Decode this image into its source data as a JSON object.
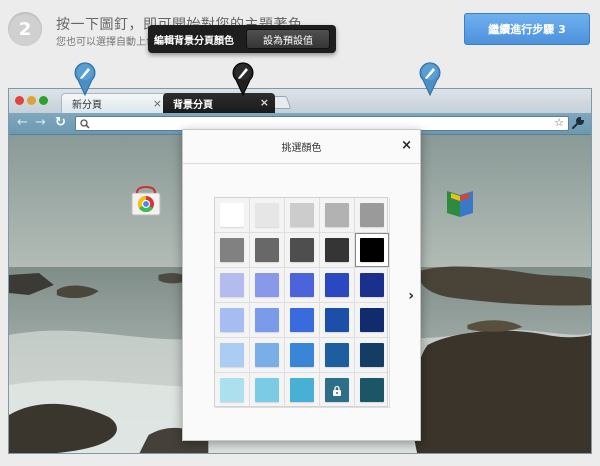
{
  "instruction": {
    "step_number": "2",
    "title": "按一下圖釘，即可開始對您的主題著色",
    "subtitle": "您也可以選擇自動上色"
  },
  "next_button": {
    "label": "繼續進行步驟 3"
  },
  "popup": {
    "label": "編輯背景分頁顏色",
    "button_label": "設為預設值"
  },
  "pins": [
    {
      "icon": "paintbrush-icon",
      "color": "#4b8fc4"
    },
    {
      "icon": "paintbrush-icon",
      "color": "#1f1f1f",
      "active": true
    },
    {
      "icon": "paintbrush-icon",
      "color": "#4b8fc4"
    }
  ],
  "browser": {
    "tabs": [
      {
        "label": "新分頁",
        "close": "×"
      },
      {
        "label": "背景分頁",
        "close": "×",
        "highlighted": true
      }
    ],
    "toolbar_icons": [
      "back-arrow-icon",
      "forward-arrow-icon",
      "reload-icon",
      "search-icon",
      "star-icon",
      "wrench-icon"
    ],
    "apps": [
      "chrome-web-store-icon",
      "book-icon"
    ]
  },
  "color_dialog": {
    "title": "挑選顏色",
    "close": "×",
    "next": "›",
    "selected_index": 9,
    "locked_index": 28,
    "colors": [
      "#ffffff",
      "#e6e6e6",
      "#cccccc",
      "#b2b2b2",
      "#9a9a9a",
      "#818181",
      "#686868",
      "#4e4e4e",
      "#353535",
      "#000000",
      "#b3bbef",
      "#8999ea",
      "#4b64dc",
      "#2a48c2",
      "#1b2f8c",
      "#a6bdf3",
      "#7a9aea",
      "#3a6bdc",
      "#1c4fa8",
      "#102c6e",
      "#aacdf1",
      "#79aee6",
      "#3a86d6",
      "#1d5f9e",
      "#143d66",
      "#ace0ef",
      "#7ccbe4",
      "#48b1d3",
      "#2d6f8a",
      "#1c5566"
    ]
  }
}
